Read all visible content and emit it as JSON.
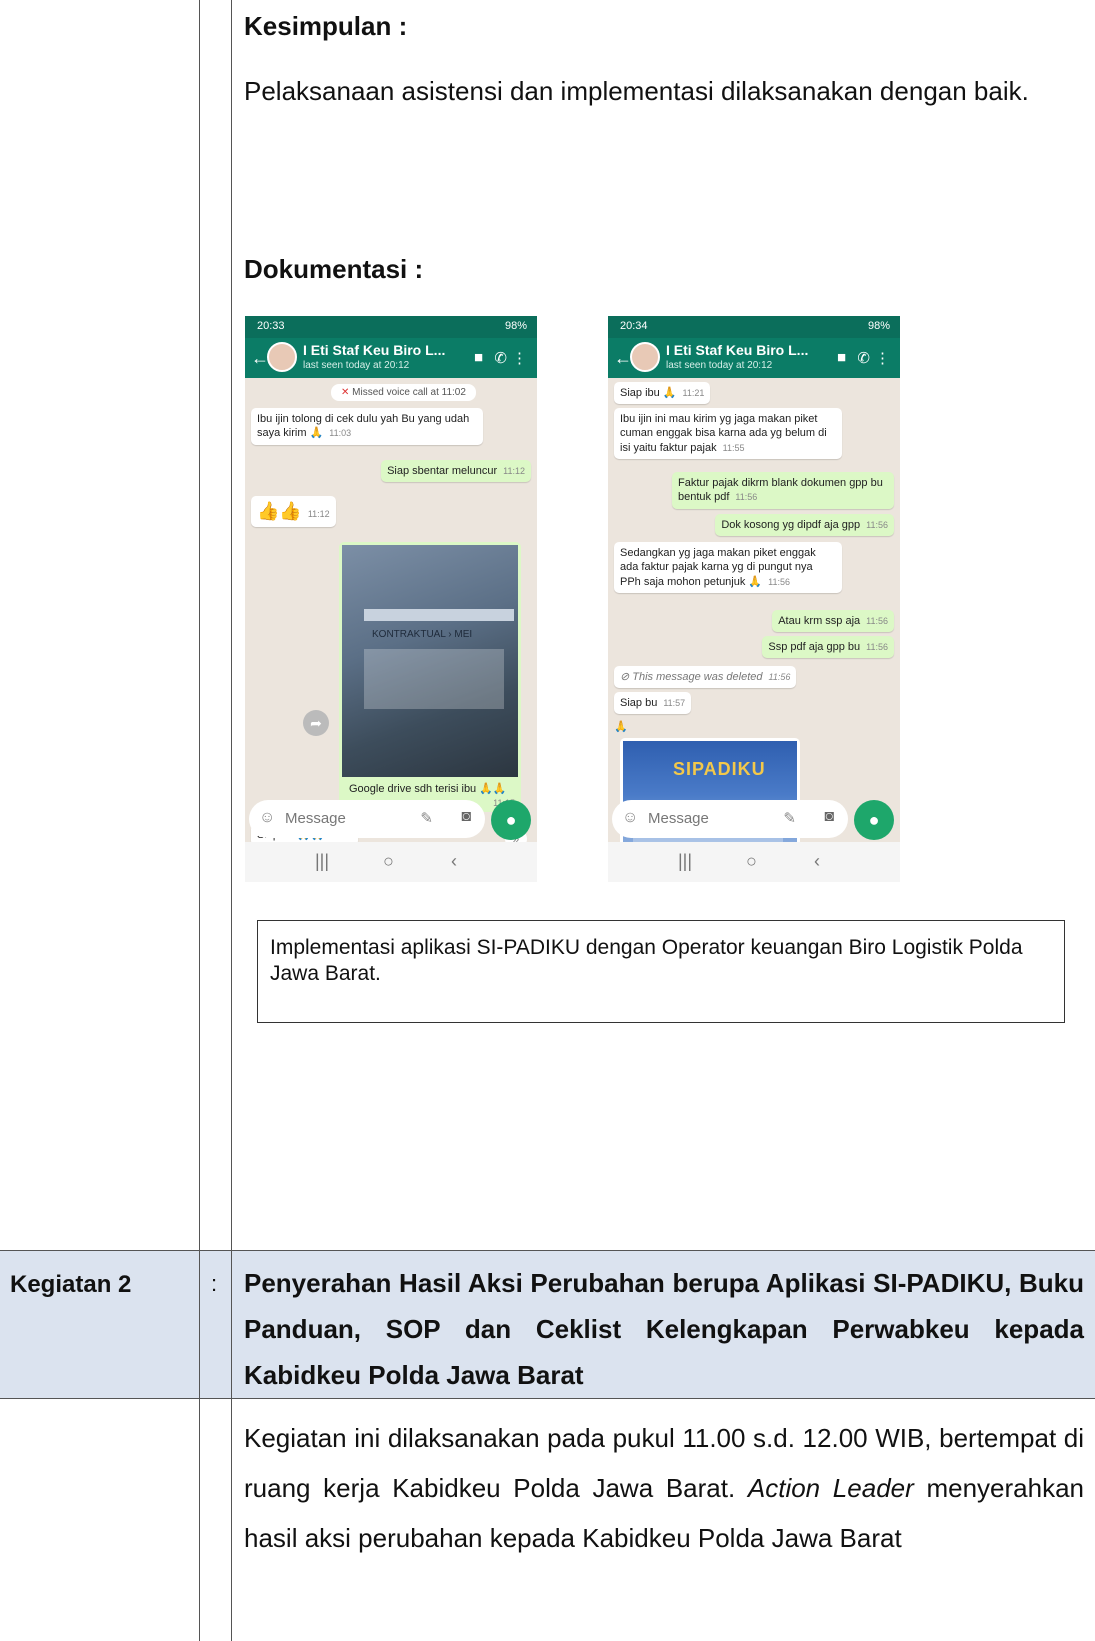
{
  "section1": {
    "kesimpulan_heading": "Kesimpulan :",
    "kesimpulan_text": "Pelaksanaan asistensi dan implementasi dilaksanakan dengan baik.",
    "dokumentasi_heading": "Dokumentasi :",
    "caption": "Implementasi aplikasi SI-PADIKU dengan Operator keuangan Biro Logistik Polda Jawa Barat."
  },
  "phone1": {
    "status_time": "20:33",
    "status_right": "98%",
    "contact_name": "I Eti Staf Keu Biro L...",
    "last_seen": "last seen today at 20:12",
    "missed_call": "Missed voice call at 11:02",
    "messages": [
      {
        "text": "Ibu ijin tolong di cek dulu yah Bu yang udah saya kirim 🙏",
        "time": "11:03"
      },
      {
        "text": "Siap sbentar meluncur",
        "time": "11:12"
      },
      {
        "text": "👍👍",
        "time": "11:12"
      },
      {
        "text": "KONTRAKTUAL › MEI",
        "time": ""
      },
      {
        "text": "Google drive sdh terisi ibu 🙏🙏",
        "time": "11:15"
      },
      {
        "text": "Siap ibu🙏🙏",
        "time": "11:16"
      }
    ],
    "input_placeholder": "Message"
  },
  "phone2": {
    "status_time": "20:34",
    "status_right": "98%",
    "contact_name": "I Eti Staf Keu Biro L...",
    "last_seen": "last seen today at 20:12",
    "messages": [
      {
        "text": "Siap ibu 🙏",
        "time": "11:21"
      },
      {
        "text": "Ibu ijin ini mau kirim yg jaga makan piket cuman enggak bisa karna ada yg belum di isi yaitu faktur pajak",
        "time": "11:55"
      },
      {
        "text": "Faktur pajak dikrm blank dokumen gpp bu bentuk pdf",
        "time": "11:56"
      },
      {
        "text": "Dok kosong yg dipdf aja gpp",
        "time": "11:56"
      },
      {
        "text": "Sedangkan yg jaga makan piket enggak ada faktur pajak karna yg di pungut nya PPh saja mohon petunjuk 🙏",
        "time": "11:56"
      },
      {
        "text": "Atau krm ssp aja",
        "time": "11:56"
      },
      {
        "text": "Ssp pdf aja gpp bu",
        "time": "11:56"
      },
      {
        "text": "This message was deleted",
        "time": "11:56"
      },
      {
        "text": "Siap bu",
        "time": "11:57"
      },
      {
        "text": "SIPADIKU",
        "time": ""
      }
    ],
    "input_placeholder": "Message"
  },
  "kegiatan2": {
    "label": "Kegiatan 2",
    "colon": ":",
    "title": "Penyerahan Hasil Aksi Perubahan berupa Aplikasi SI-PADIKU, Buku Panduan, SOP dan Ceklist Kelengkapan Perwabkeu kepada Kabidkeu Polda Jawa Barat",
    "body_part1": "Kegiatan ini dilaksanakan pada pukul 11.00 s.d. 12.00 WIB, bertempat di ruang kerja Kabidkeu Polda Jawa Barat. ",
    "body_italic": "Action Leader",
    "body_part2": " menyerahkan hasil aksi perubahan kepada Kabidkeu Polda Jawa Barat"
  }
}
